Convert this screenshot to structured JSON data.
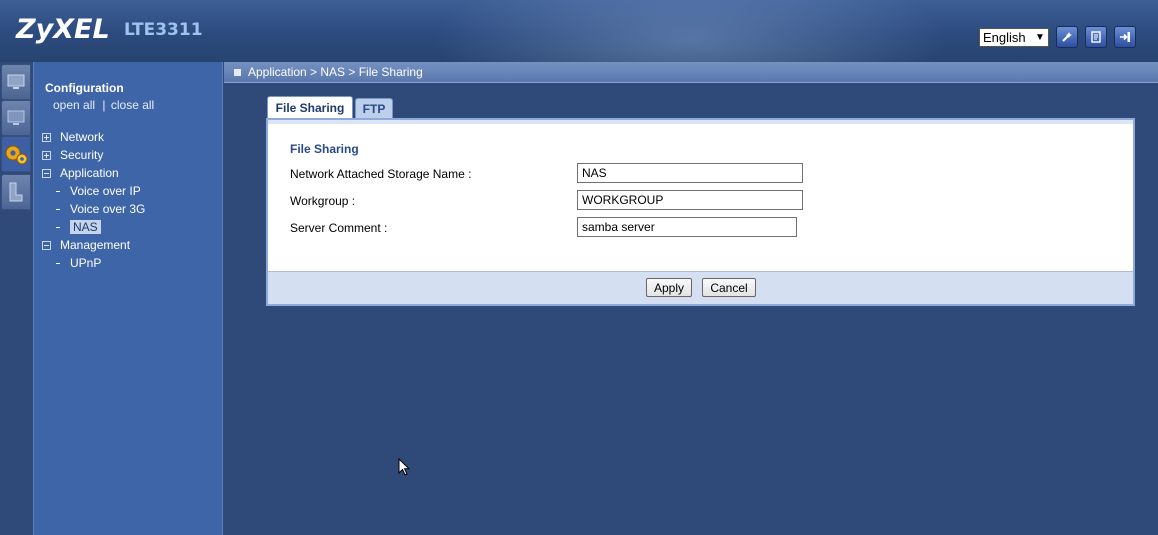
{
  "header": {
    "logo": "ZyXEL",
    "model": "LTE3311",
    "language": "English",
    "icons": [
      "wizard-icon",
      "log-icon",
      "logout-icon"
    ]
  },
  "icon_strip": [
    "status-monitor-icon",
    "system-monitor-icon",
    "configuration-gears-icon",
    "maintenance-icon"
  ],
  "sidebar": {
    "title": "Configuration",
    "open_all": "open all",
    "separator": "|",
    "close_all": "close all",
    "items": [
      {
        "label": "Network",
        "state": "collapsed"
      },
      {
        "label": "Security",
        "state": "collapsed"
      },
      {
        "label": "Application",
        "state": "expanded"
      },
      {
        "label": "Voice over IP"
      },
      {
        "label": "Voice over 3G"
      },
      {
        "label": "NAS",
        "active": true
      },
      {
        "label": "Management",
        "state": "expanded"
      },
      {
        "label": "UPnP"
      }
    ]
  },
  "breadcrumb": "Application > NAS > File Sharing",
  "tabs": [
    {
      "label": "File Sharing",
      "active": true
    },
    {
      "label": "FTP",
      "active": false
    }
  ],
  "form": {
    "section_title": "File Sharing",
    "fields": [
      {
        "label": "Network Attached Storage Name :",
        "value": "NAS"
      },
      {
        "label": "Workgroup :",
        "value": "WORKGROUP"
      },
      {
        "label": "Server Comment :",
        "value": "samba server"
      }
    ],
    "apply_label": "Apply",
    "cancel_label": "Cancel"
  },
  "colors": {
    "background": "#2f4a78",
    "sidebar": "#3e65a8",
    "accent_text": "#2a4a88"
  }
}
